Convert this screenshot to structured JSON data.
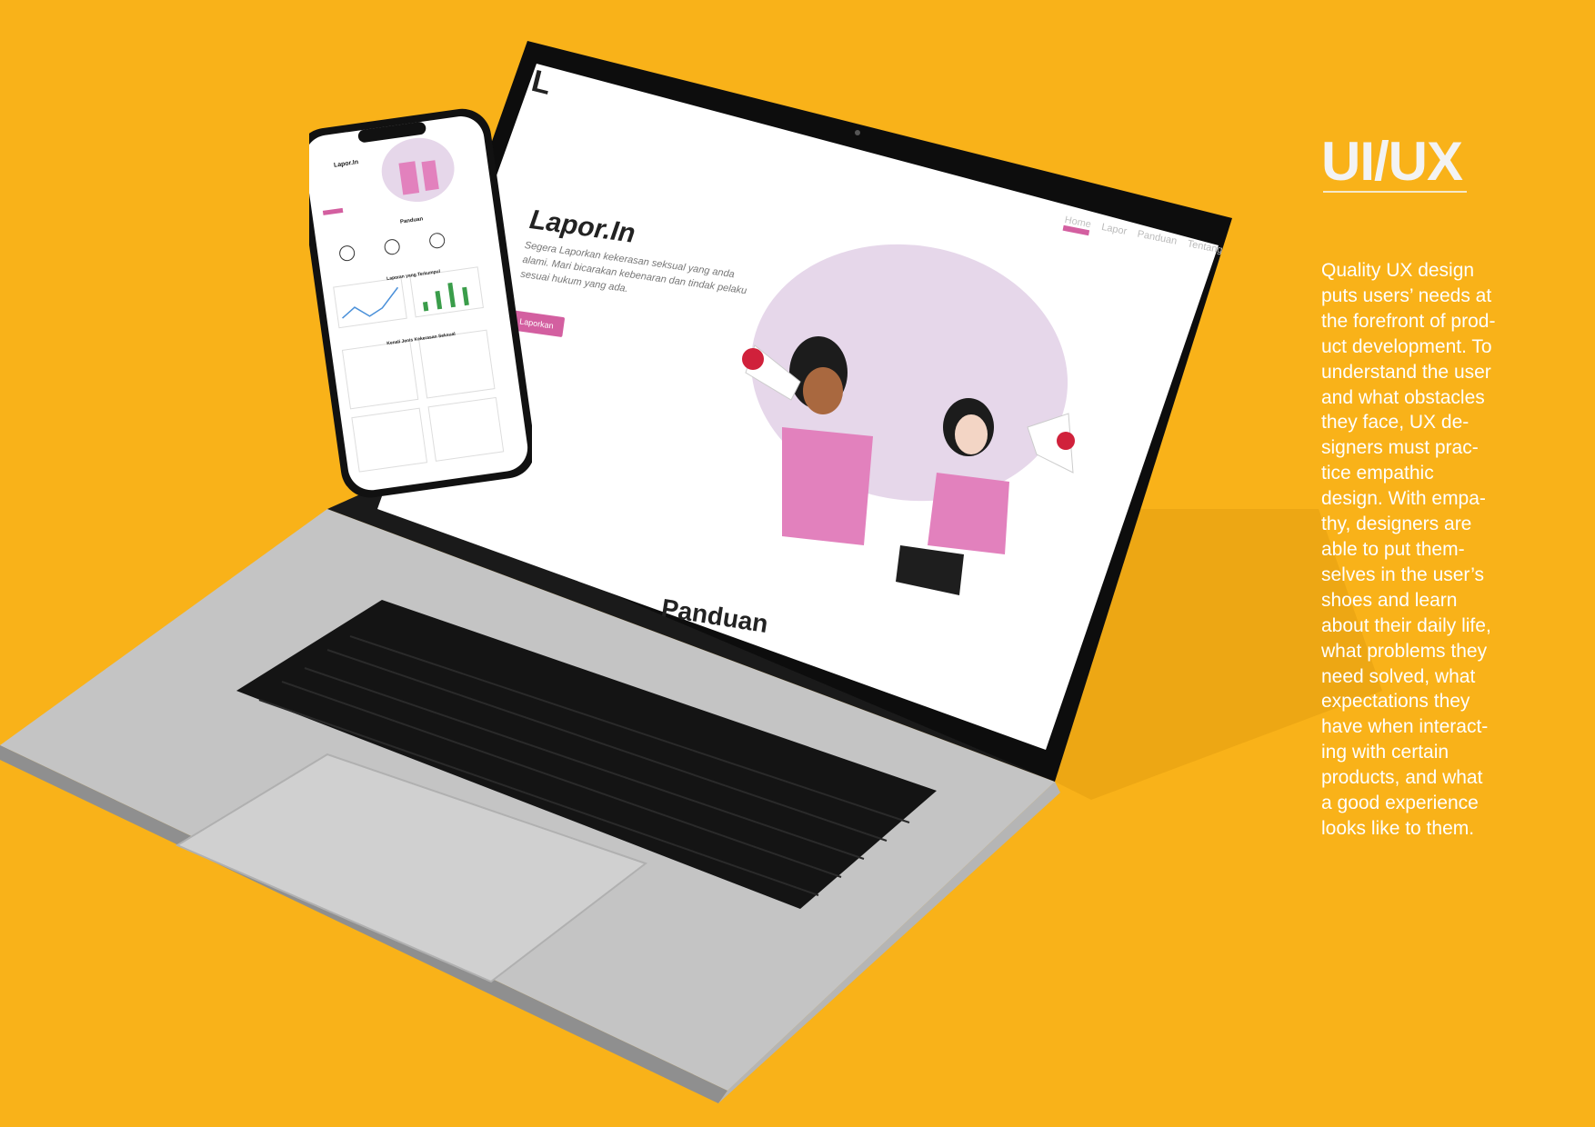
{
  "colors": {
    "background": "#f9b219",
    "accent_pink": "#d35fa0",
    "laptop_silver": "#c9c9c9",
    "keyboard_black": "#141414"
  },
  "website": {
    "logo": "L",
    "title": "Lapor.In",
    "description": "Segera Laporkan kekerasan seksual yang anda alami. Mari bicarakan kebenaran dan tindak pelaku sesuai hukum yang ada.",
    "cta_label": "Laporkan",
    "nav": [
      "Home",
      "Lapor",
      "Panduan",
      "Tentang"
    ],
    "guide_heading": "Panduan"
  },
  "phone": {
    "title": "Lapor.In",
    "sections": [
      "Panduan",
      "Laporan yang Terkumpul",
      "Kenali Jenis Kekerasan Seksual"
    ]
  },
  "panel": {
    "title": "UI/UX",
    "body_lines": [
      "Quality UX design",
      "puts users’ needs at",
      "the forefront of prod-",
      "uct development. To",
      "understand the user",
      "and what obstacles",
      "they face, UX de-",
      "signers must prac-",
      "tice empathic",
      "design. With empa-",
      "thy, designers are",
      "able to put them-",
      "selves in the user’s",
      "shoes and learn",
      "about their daily life,",
      "what problems they",
      "need solved, what",
      "expectations they",
      "have when interact-",
      "ing with certain",
      "products, and what",
      "a good experience",
      "looks like to them."
    ]
  }
}
